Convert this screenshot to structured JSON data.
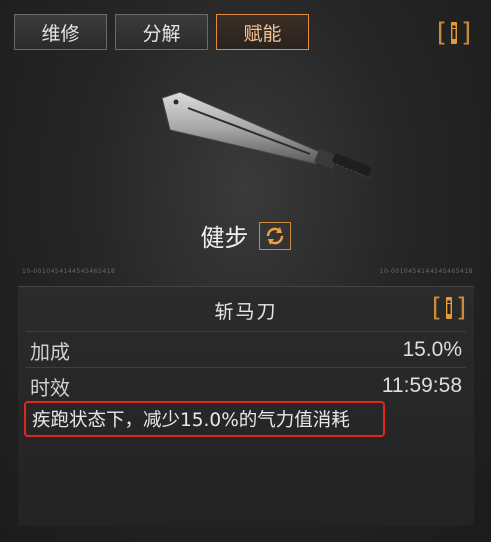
{
  "tabs": [
    {
      "label": "维修",
      "active": false
    },
    {
      "label": "分解",
      "active": false
    },
    {
      "label": "赋能",
      "active": true
    }
  ],
  "info_button": {
    "left": "[",
    "mid": "i",
    "right": "]"
  },
  "skill": {
    "name": "健步",
    "icon": "refresh-icon"
  },
  "serials": {
    "left": "10-0010454144545465418",
    "right": "10-0010454144545465418"
  },
  "detail": {
    "title": "斩马刀",
    "rows": [
      {
        "label": "加成",
        "value": "15.0%"
      },
      {
        "label": "时效",
        "value": "11:59:58"
      }
    ],
    "effect": "疾跑状态下，减少15.0%的气力值消耗"
  },
  "colors": {
    "accent": "#e28a3e",
    "highlight": "#e2261c",
    "background": "#1c1c1c"
  }
}
